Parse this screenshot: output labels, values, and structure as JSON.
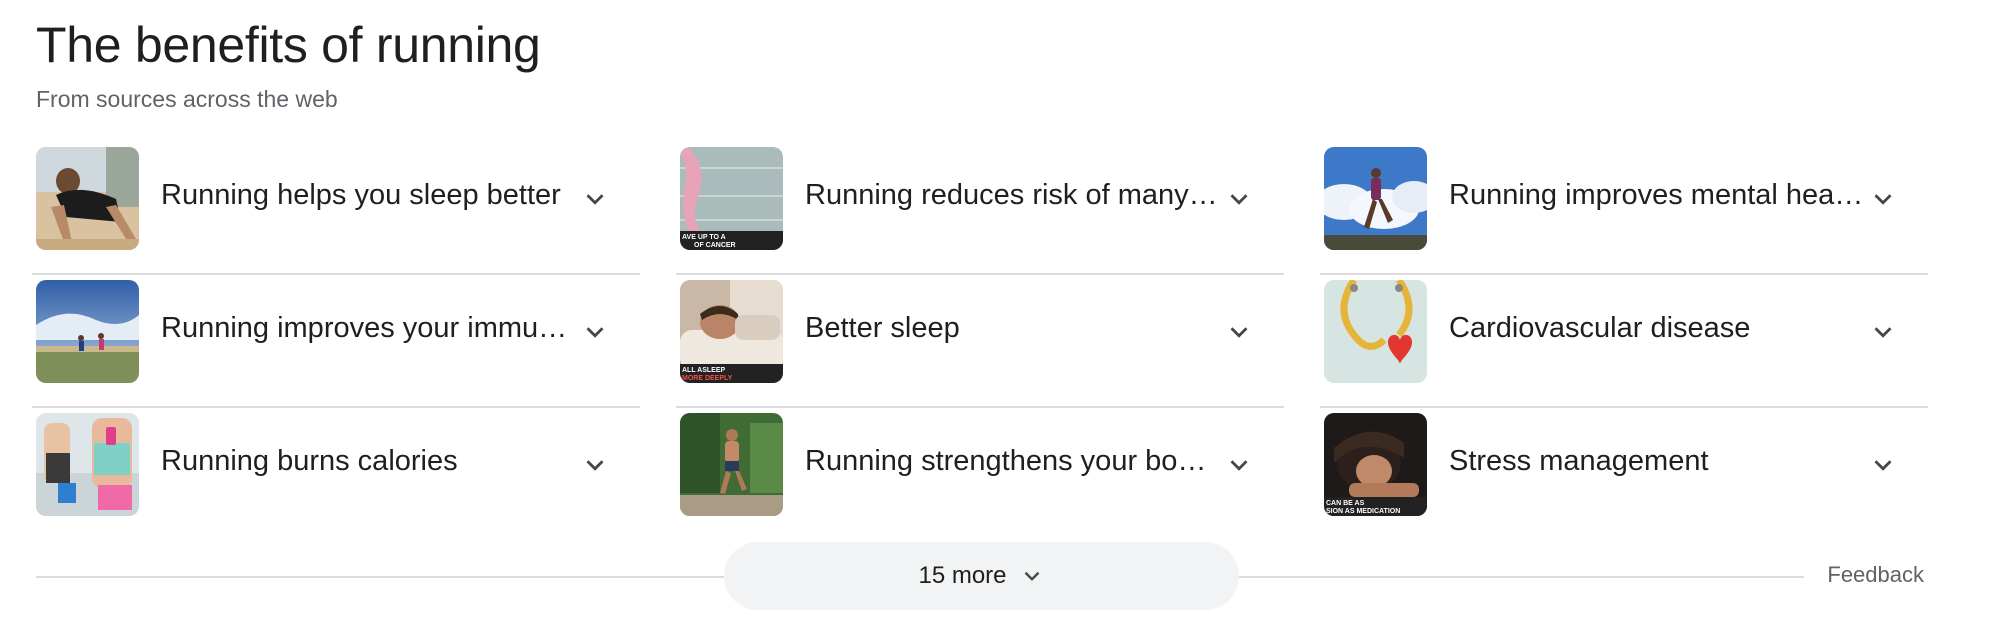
{
  "header": {
    "title": "The benefits of running",
    "subtitle": "From sources across the web"
  },
  "columns": [
    {
      "items": [
        {
          "label": "Running helps you sleep better",
          "thumb": "woman-resting-on-knees-beach"
        },
        {
          "label": "Running improves your immu…",
          "thumb": "runners-field-sky"
        },
        {
          "label": "Running burns calories",
          "thumb": "runners-armband"
        }
      ]
    },
    {
      "items": [
        {
          "label": "Running reduces risk of many…",
          "thumb": "pink-ribbon-cancer",
          "thumb_caption_1": "AVE UP TO A",
          "thumb_caption_2": "OF CANCER"
        },
        {
          "label": "Better sleep",
          "thumb": "man-sleeping-pillow",
          "thumb_caption_1": "ALL ASLEEP",
          "thumb_caption_2": "MORE DEEPLY"
        },
        {
          "label": "Running strengthens your bo…",
          "thumb": "man-running-trail"
        }
      ]
    },
    {
      "items": [
        {
          "label": "Running improves mental hea…",
          "thumb": "runner-clouds"
        },
        {
          "label": "Cardiovascular disease",
          "thumb": "stethoscope-heart"
        },
        {
          "label": "Stress management",
          "thumb": "woman-head-down",
          "thumb_caption_1": "CAN BE AS",
          "thumb_caption_2": "SION AS MEDICATION"
        }
      ]
    }
  ],
  "footer": {
    "more_label": "15 more",
    "feedback_label": "Feedback"
  },
  "colors": {
    "title": "#1f1f1f",
    "secondary_text": "#5f6368",
    "divider": "#dadce0",
    "button_bg": "#f1f3f4",
    "chevron": "#444746"
  },
  "icons": {
    "expand": "chevron-down-icon"
  }
}
